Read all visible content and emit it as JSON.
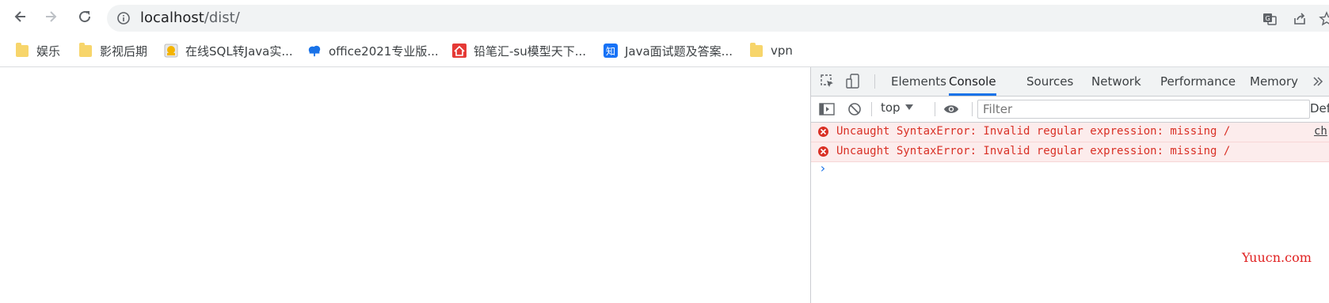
{
  "toolbar": {
    "url_host": "localhost",
    "url_path": "/dist/"
  },
  "bookmarks": [
    {
      "label": "娱乐",
      "icon": "folder-icon"
    },
    {
      "label": "影视后期",
      "icon": "folder-icon"
    },
    {
      "label": "在线SQL转Java实...",
      "icon": "sql-site-icon"
    },
    {
      "label": "office2021专业版...",
      "icon": "cloud-icon"
    },
    {
      "label": "铅笔汇-su模型天下...",
      "icon": "house-icon"
    },
    {
      "label": "Java面试题及答案...",
      "icon": "zhihu-icon",
      "icon_text": "知"
    },
    {
      "label": "vpn",
      "icon": "folder-icon"
    }
  ],
  "devtools": {
    "tabs": [
      "Elements",
      "Console",
      "Sources",
      "Network",
      "Performance",
      "Memory"
    ],
    "active_tab": "Console",
    "context": "top",
    "filter_placeholder": "Filter",
    "levels_label": "Def",
    "messages": [
      {
        "text": "Uncaught SyntaxError: Invalid regular expression: missing /",
        "source": "ch"
      },
      {
        "text": "Uncaught SyntaxError: Invalid regular expression: missing /",
        "source": ""
      }
    ],
    "prompt": "›"
  },
  "watermark": "Yuucn.com",
  "colors": {
    "accent": "#1a73e8",
    "error": "#d93025",
    "error_bg": "#fcecec",
    "toolbar_bg": "#f1f3f4"
  }
}
